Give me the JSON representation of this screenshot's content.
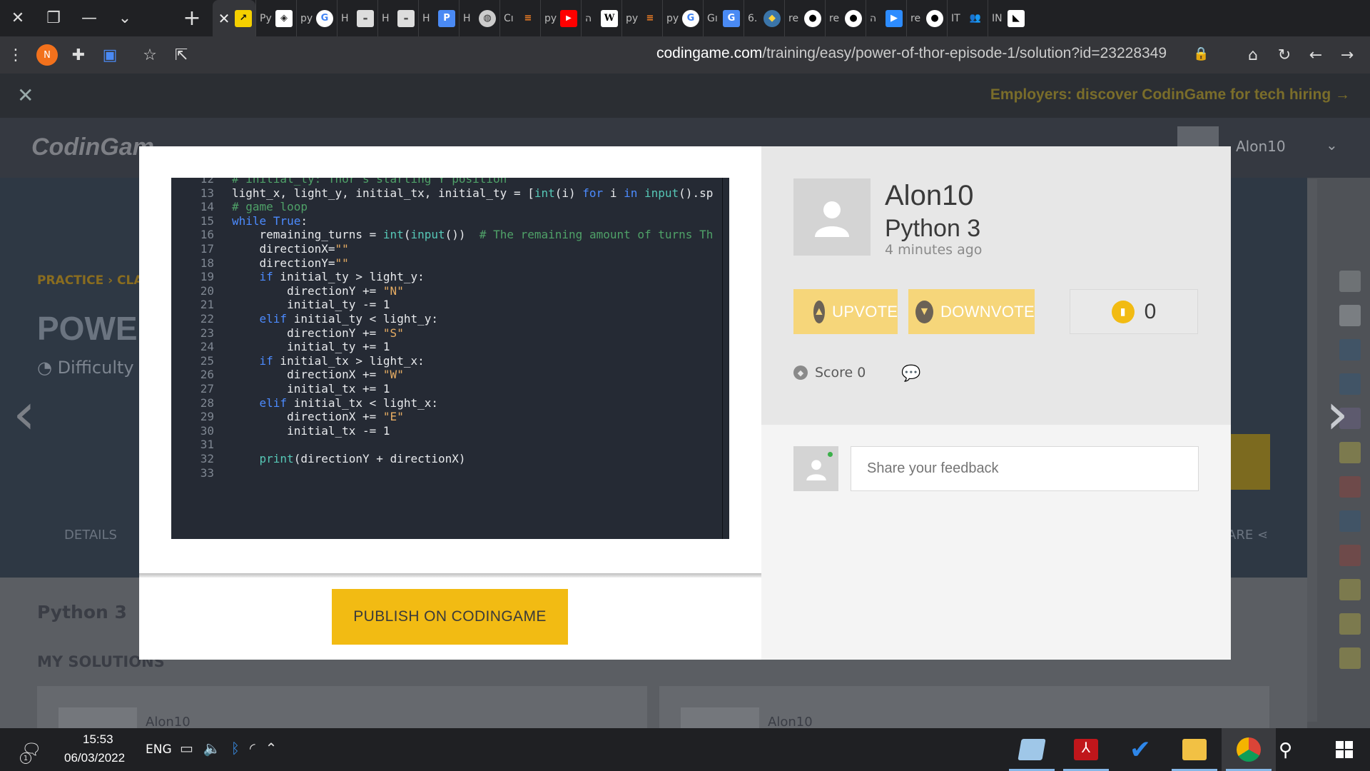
{
  "browser": {
    "tab_labels": [
      "Py",
      "py",
      "H",
      "H",
      "H",
      "H",
      "Cı",
      "py",
      "ה",
      "py",
      "py",
      "Gı",
      "6.",
      "re",
      "re",
      "ה",
      "re",
      "IT",
      "IN"
    ],
    "url_domain": "codingame.com",
    "url_path": "/training/easy/power-of-thor-episode-1/solution?id=23228349",
    "profile_initial": "N"
  },
  "page": {
    "banner_text": "Employers: discover CodinGame for tech hiring →",
    "logo": "CodinGam",
    "username": "Alon10",
    "breadcrumb": "PRACTICE › CLA",
    "title": "POWE",
    "difficulty": "Difficulty",
    "tab_details": "DETAILS",
    "tab_share": "ARE",
    "language": "Python 3",
    "my_solutions": "MY SOLUTIONS",
    "solution_authors": [
      "Alon10",
      "Alon10"
    ]
  },
  "modal": {
    "code_lines": [
      {
        "n": "12",
        "t": "# initial_ty: Thor's starting Y position"
      },
      {
        "n": "13",
        "t": "light_x, light_y, initial_tx, initial_ty = [int(i) for i in input().sp"
      },
      {
        "n": "14",
        "t": "# game loop"
      },
      {
        "n": "15",
        "t": "while True:"
      },
      {
        "n": "16",
        "t": "    remaining_turns = int(input())  # The remaining amount of turns Th"
      },
      {
        "n": "17",
        "t": "    directionX=\"\""
      },
      {
        "n": "18",
        "t": "    directionY=\"\""
      },
      {
        "n": "19",
        "t": "    if initial_ty > light_y:"
      },
      {
        "n": "20",
        "t": "        directionY += \"N\""
      },
      {
        "n": "21",
        "t": "        initial_ty -= 1"
      },
      {
        "n": "22",
        "t": "    elif initial_ty < light_y:"
      },
      {
        "n": "23",
        "t": "        directionY += \"S\""
      },
      {
        "n": "24",
        "t": "        initial_ty += 1"
      },
      {
        "n": "25",
        "t": "    if initial_tx > light_x:"
      },
      {
        "n": "26",
        "t": "        directionX += \"W\""
      },
      {
        "n": "27",
        "t": "        initial_tx += 1"
      },
      {
        "n": "28",
        "t": "    elif initial_tx < light_x:"
      },
      {
        "n": "29",
        "t": "        directionX += \"E\""
      },
      {
        "n": "30",
        "t": "        initial_tx -= 1"
      },
      {
        "n": "31",
        "t": ""
      },
      {
        "n": "32",
        "t": "    print(directionY + directionX)"
      },
      {
        "n": "33",
        "t": ""
      }
    ],
    "publish_label": "PUBLISH ON CODINGAME",
    "author_name": "Alon10",
    "author_language": "Python 3",
    "posted_time": "4 minutes ago",
    "upvote_label": "UPVOTE",
    "downvote_label": "DOWNVOTE",
    "vote_count": "0",
    "score_label": "Score 0",
    "feedback_placeholder": "Share your feedback"
  },
  "taskbar": {
    "notification_count": "1",
    "time": "15:53",
    "date": "06/03/2022",
    "language": "ENG"
  },
  "colors": {
    "accent_yellow": "#f2bb13",
    "vote_yellow": "#f6d67a",
    "code_bg": "#252a34"
  }
}
